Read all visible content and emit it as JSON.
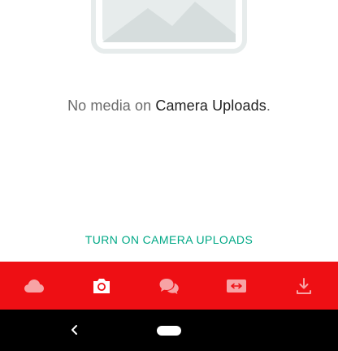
{
  "empty_state": {
    "message_prefix": "No media on ",
    "message_highlight": "Camera Uploads",
    "message_suffix": ".",
    "enable_button_label": "TURN ON CAMERA UPLOADS",
    "illustration_icon": "image-placeholder-icon"
  },
  "bottom_nav": {
    "background_color": "#ee0f14",
    "icon_color_inactive": "#f7a3a5",
    "icon_color_active": "#ffffff",
    "items": [
      {
        "icon": "cloud-drive-icon",
        "active": false
      },
      {
        "icon": "camera-uploads-icon",
        "active": true
      },
      {
        "icon": "chat-icon",
        "active": false
      },
      {
        "icon": "shared-items-icon",
        "active": false
      },
      {
        "icon": "offline-download-icon",
        "active": false
      }
    ]
  },
  "system_nav": {
    "back_icon": "back-chevron-icon",
    "home_icon": "home-pill-icon"
  },
  "colors": {
    "accent": "#00a886",
    "text_primary": "#1f1f1f",
    "text_secondary": "#6b6b6b"
  }
}
